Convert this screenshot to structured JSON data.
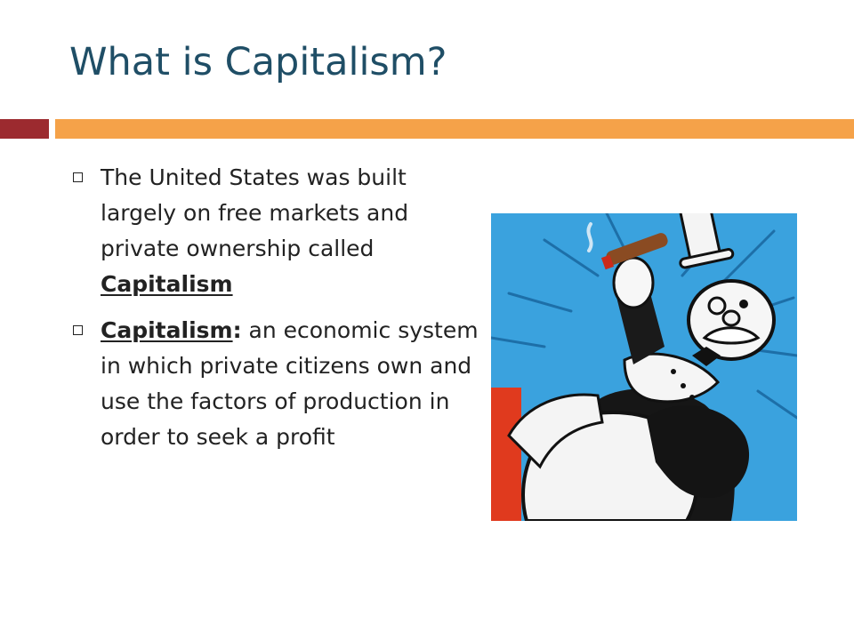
{
  "slide": {
    "title": "What is Capitalism?",
    "bullets": [
      {
        "lead": "The United States was built largely on free markets and private ownership called ",
        "term": "Capitalism",
        "rest": ""
      },
      {
        "lead": "",
        "term": "Capitalism",
        "colon": ":",
        "rest": " an economic system in which private citizens own and use the factors of production in order to seek a profit"
      }
    ],
    "picture_icon": "rich-man-with-cigar-illustration"
  },
  "colors": {
    "title": "#1f4e66",
    "rule_left": "#9c2a2f",
    "rule_right": "#f5a249",
    "body_text": "#222222",
    "illustration_sky": "#3aa2de",
    "illustration_red": "#e03a1e"
  }
}
